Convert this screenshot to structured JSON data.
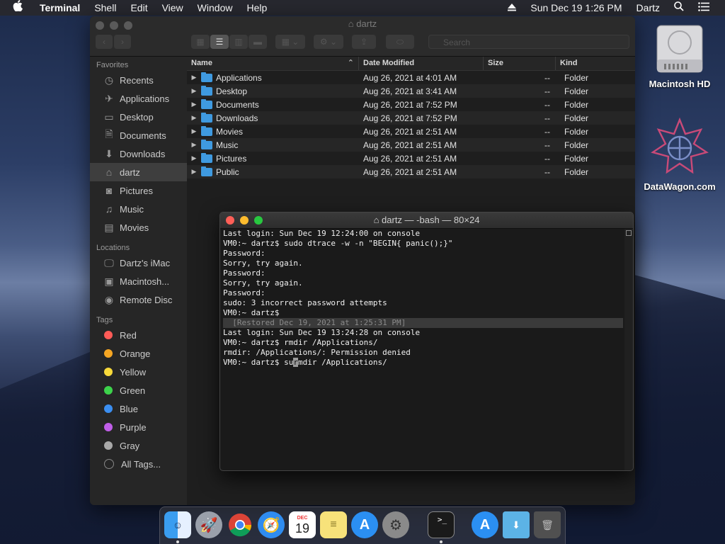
{
  "menubar": {
    "app_name": "Terminal",
    "items": [
      "Shell",
      "Edit",
      "View",
      "Window",
      "Help"
    ],
    "datetime": "Sun Dec 19  1:26 PM",
    "user": "Dartz"
  },
  "finder": {
    "title": "dartz",
    "search_placeholder": "Search",
    "sidebar": {
      "favorites_label": "Favorites",
      "favorites": [
        {
          "label": "Recents",
          "icon": "recents-icon"
        },
        {
          "label": "Applications",
          "icon": "applications-icon"
        },
        {
          "label": "Desktop",
          "icon": "desktop-icon"
        },
        {
          "label": "Documents",
          "icon": "documents-icon"
        },
        {
          "label": "Downloads",
          "icon": "downloads-icon"
        },
        {
          "label": "dartz",
          "icon": "home-icon"
        },
        {
          "label": "Pictures",
          "icon": "pictures-icon"
        },
        {
          "label": "Music",
          "icon": "music-icon"
        },
        {
          "label": "Movies",
          "icon": "movies-icon"
        }
      ],
      "locations_label": "Locations",
      "locations": [
        {
          "label": "Dartz's iMac",
          "icon": "imac-icon"
        },
        {
          "label": "Macintosh...",
          "icon": "disk-icon"
        },
        {
          "label": "Remote Disc",
          "icon": "disc-icon"
        }
      ],
      "tags_label": "Tags",
      "tags": [
        {
          "label": "Red",
          "color": "#ff5b57"
        },
        {
          "label": "Orange",
          "color": "#f5a623"
        },
        {
          "label": "Yellow",
          "color": "#f8d93a"
        },
        {
          "label": "Green",
          "color": "#3dd34b"
        },
        {
          "label": "Blue",
          "color": "#3b8ef0"
        },
        {
          "label": "Purple",
          "color": "#c05ee8"
        },
        {
          "label": "Gray",
          "color": "#a8a8a8"
        }
      ],
      "all_tags": "All Tags..."
    },
    "columns": {
      "name": "Name",
      "date": "Date Modified",
      "size": "Size",
      "kind": "Kind"
    },
    "rows": [
      {
        "name": "Applications",
        "date": "Aug 26, 2021 at 4:01 AM",
        "size": "--",
        "kind": "Folder"
      },
      {
        "name": "Desktop",
        "date": "Aug 26, 2021 at 3:41 AM",
        "size": "--",
        "kind": "Folder"
      },
      {
        "name": "Documents",
        "date": "Aug 26, 2021 at 7:52 PM",
        "size": "--",
        "kind": "Folder"
      },
      {
        "name": "Downloads",
        "date": "Aug 26, 2021 at 7:52 PM",
        "size": "--",
        "kind": "Folder"
      },
      {
        "name": "Movies",
        "date": "Aug 26, 2021 at 2:51 AM",
        "size": "--",
        "kind": "Folder"
      },
      {
        "name": "Music",
        "date": "Aug 26, 2021 at 2:51 AM",
        "size": "--",
        "kind": "Folder"
      },
      {
        "name": "Pictures",
        "date": "Aug 26, 2021 at 2:51 AM",
        "size": "--",
        "kind": "Folder"
      },
      {
        "name": "Public",
        "date": "Aug 26, 2021 at 2:51 AM",
        "size": "--",
        "kind": "Folder"
      }
    ]
  },
  "terminal": {
    "title": "dartz — -bash — 80×24",
    "lines": [
      {
        "text": "Last login: Sun Dec 19 12:24:00 on console",
        "restored": false
      },
      {
        "text": "VM0:~ dartz$ sudo dtrace -w -n \"BEGIN{ panic();}\"",
        "restored": false
      },
      {
        "text": "Password:",
        "restored": false
      },
      {
        "text": "Sorry, try again.",
        "restored": false
      },
      {
        "text": "Password:",
        "restored": false
      },
      {
        "text": "Sorry, try again.",
        "restored": false
      },
      {
        "text": "Password:",
        "restored": false
      },
      {
        "text": "sudo: 3 incorrect password attempts",
        "restored": false
      },
      {
        "text": "VM0:~ dartz$",
        "restored": false
      },
      {
        "text": "  [Restored Dec 19, 2021 at 1:25:31 PM]",
        "restored": true
      },
      {
        "text": "Last login: Sun Dec 19 13:24:28 on console",
        "restored": false
      },
      {
        "text": "VM0:~ dartz$ rmdir /Applications/",
        "restored": false
      },
      {
        "text": "rmdir: /Applications/: Permission denied",
        "restored": false
      }
    ],
    "current_prefix": "VM0:~ dartz$ su",
    "current_cursor_char": "r",
    "current_suffix": "mdir /Applications/"
  },
  "desktop": {
    "icons": [
      {
        "label": "Macintosh HD",
        "icon": "hard-drive-icon"
      },
      {
        "label": "DataWagon.com",
        "icon": "datawagon-logo-icon"
      }
    ]
  },
  "dock": {
    "apps": [
      {
        "name": "Finder",
        "icon": "finder-icon",
        "color": "#3a9df0"
      },
      {
        "name": "Launchpad",
        "icon": "launchpad-icon",
        "color": "#8c8f98"
      },
      {
        "name": "Chrome",
        "icon": "chrome-icon",
        "color": "#ffffff"
      },
      {
        "name": "Safari",
        "icon": "safari-icon",
        "color": "#2f8cf0"
      },
      {
        "name": "Calendar",
        "icon": "calendar-icon",
        "color": "#ffffff"
      },
      {
        "name": "Notes",
        "icon": "notes-icon",
        "color": "#f7e27a"
      },
      {
        "name": "App Store",
        "icon": "appstore-icon",
        "color": "#2b8ff2"
      },
      {
        "name": "System Preferences",
        "icon": "system-preferences-icon",
        "color": "#8a8a8a"
      },
      {
        "name": "Terminal",
        "icon": "terminal-icon",
        "color": "#1a1a1a"
      },
      {
        "name": "Applications",
        "icon": "applications-folder-icon",
        "color": "#2b8ff2"
      },
      {
        "name": "Downloads",
        "icon": "downloads-folder-icon",
        "color": "#5cb3e6"
      },
      {
        "name": "Trash",
        "icon": "trash-icon",
        "color": "#505050"
      }
    ],
    "calendar_month": "DEC",
    "calendar_day": "19"
  }
}
